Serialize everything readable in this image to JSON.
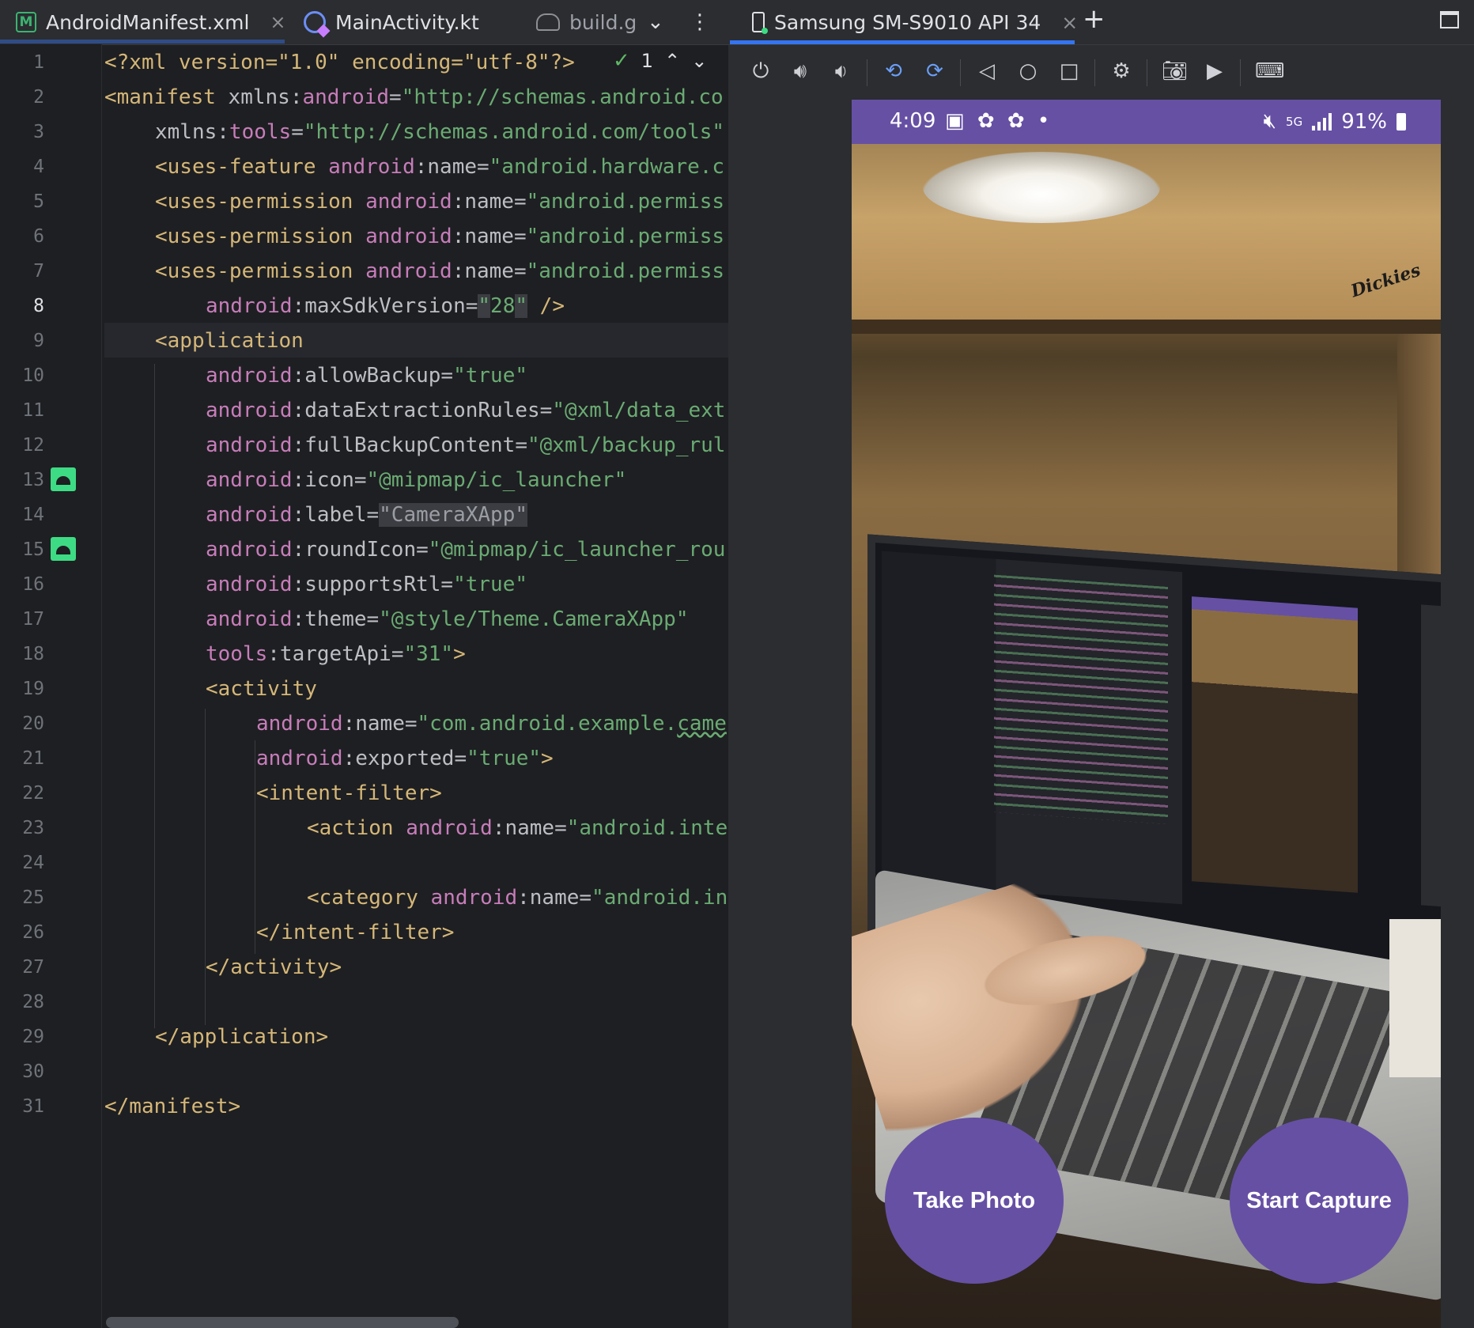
{
  "editor": {
    "tabs": [
      {
        "label": "AndroidManifest.xml",
        "icon": "manifest-icon",
        "close": "×"
      },
      {
        "label": "MainActivity.kt",
        "icon": "kotlin-icon"
      },
      {
        "label": "build.g",
        "icon": "gradle-icon"
      }
    ],
    "tab_overflow": "⌄",
    "tab_menu": "⋮",
    "inspection": {
      "icon": "check-icon",
      "count": "1",
      "up": "⌃",
      "down": "⌄"
    },
    "line_numbers": [
      "1",
      "2",
      "3",
      "4",
      "5",
      "6",
      "7",
      "8",
      "9",
      "10",
      "11",
      "12",
      "13",
      "14",
      "15",
      "16",
      "17",
      "18",
      "19",
      "20",
      "21",
      "22",
      "23",
      "24",
      "25",
      "26",
      "27",
      "28",
      "29",
      "30",
      "31"
    ],
    "current_line": "8",
    "code": {
      "l1": {
        "decl": "<?xml version=\"1.0\" encoding=\"utf-8\"?>"
      },
      "l2": {
        "tag": "<manifest ",
        "attr_plain": "xmlns:",
        "attr": "android",
        "eq": "=",
        "val": "\"http://schemas.android.co"
      },
      "l3": {
        "attr_plain": "xmlns:",
        "attr": "tools",
        "eq": "=",
        "val": "\"http://schemas.android.com/tools\""
      },
      "l4": {
        "tag": "<uses-feature ",
        "attr": "android",
        "name": ":name=",
        "val": "\"android.hardware.c"
      },
      "l5": {
        "tag": "<uses-permission ",
        "attr": "android",
        "name": ":name=",
        "val": "\"android.permiss"
      },
      "l6": {
        "tag": "<uses-permission ",
        "attr": "android",
        "name": ":name=",
        "val": "\"android.permiss"
      },
      "l7": {
        "tag": "<uses-permission ",
        "attr": "android",
        "name": ":name=",
        "val": "\"android.permiss"
      },
      "l8": {
        "attr": "android",
        "name": ":maxSdkVersion=",
        "q1": "\"",
        "val": "28",
        "q2": "\"",
        "close": " />"
      },
      "l9": {
        "tag": "<application"
      },
      "l10": {
        "attr": "android",
        "name": ":allowBackup=",
        "val": "\"true\""
      },
      "l11": {
        "attr": "android",
        "name": ":dataExtractionRules=",
        "val": "\"@xml/data_ext"
      },
      "l12": {
        "attr": "android",
        "name": ":fullBackupContent=",
        "val": "\"@xml/backup_rul"
      },
      "l13": {
        "attr": "android",
        "name": ":icon=",
        "val": "\"@mipmap/ic_launcher\""
      },
      "l14": {
        "attr": "android",
        "name": ":label=",
        "val": "\"CameraXApp\""
      },
      "l15": {
        "attr": "android",
        "name": ":roundIcon=",
        "val": "\"@mipmap/ic_launcher_rou"
      },
      "l16": {
        "attr": "android",
        "name": ":supportsRtl=",
        "val": "\"true\""
      },
      "l17": {
        "attr": "android",
        "name": ":theme=",
        "val": "\"@style/Theme.CameraXApp\""
      },
      "l18": {
        "attr": "tools",
        "name": ":targetApi=",
        "val": "\"31\"",
        "close": ">"
      },
      "l19": {
        "tag": "<activity"
      },
      "l20": {
        "attr": "android",
        "name": ":name=",
        "val": "\"com.android.example.",
        "val_squig": "came"
      },
      "l21": {
        "attr": "android",
        "name": ":exported=",
        "val": "\"true\"",
        "close": ">"
      },
      "l22": {
        "tag": "<intent-filter>"
      },
      "l23": {
        "tag": "<action ",
        "attr": "android",
        "name": ":name=",
        "val": "\"android.inte"
      },
      "l25": {
        "tag": "<category ",
        "attr": "android",
        "name": ":name=",
        "val": "\"android.in"
      },
      "l26": {
        "tag": "</intent-filter>"
      },
      "l27": {
        "tag": "</activity>"
      },
      "l29": {
        "tag": "</application>"
      },
      "l31": {
        "tag": "</manifest>"
      }
    }
  },
  "emulator": {
    "tab_label": "Samsung SM-S9010 API 34",
    "tab_close": "×",
    "add_tab": "+",
    "toolbar": [
      "power-icon",
      "volume-up-icon",
      "volume-down-icon",
      "rotate-left-icon",
      "rotate-right-icon",
      "back-icon",
      "home-icon",
      "overview-icon",
      "device-settings-icon",
      "screenshot-icon",
      "screen-record-icon",
      "keyboard-icon"
    ],
    "phone": {
      "status_time": "4:09",
      "status_left_icons": "▣ ✿ ✿ •",
      "status_network": "5G",
      "status_battery": "91%",
      "watermark_brand": "Dickies",
      "buttons": {
        "take_photo": "Take Photo",
        "start_capture": "Start Capture"
      }
    }
  },
  "colors": {
    "accent": "#3574f0",
    "phone_purple": "#6650a4",
    "xml_tag": "#d5b778",
    "xml_attr": "#c77dba",
    "xml_string": "#6aab73"
  }
}
